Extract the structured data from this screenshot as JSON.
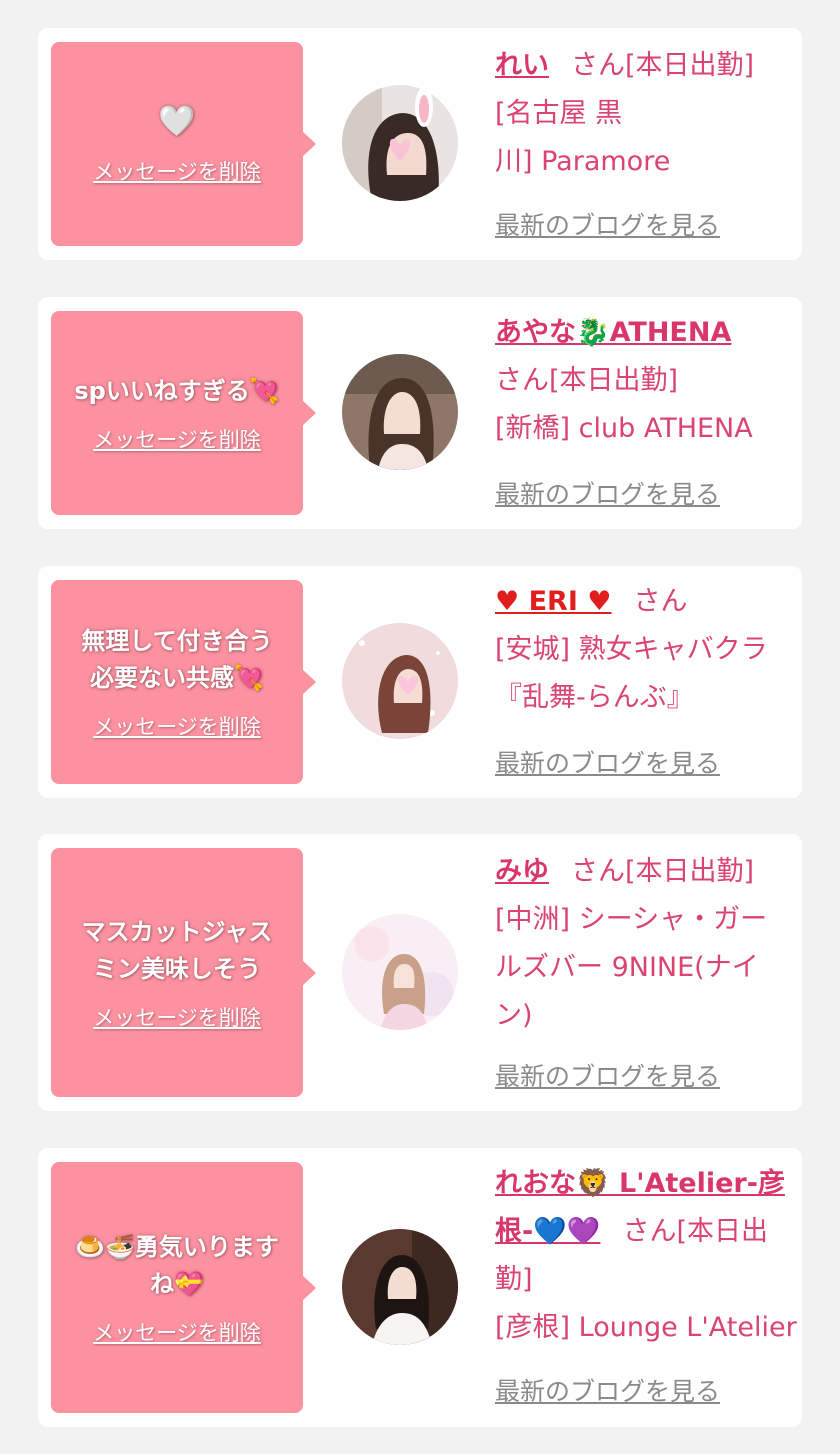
{
  "delete_label": "メッセージを削除",
  "blog_label": "最新のブログを見る",
  "colors": {
    "page_background": "#f2f2f2",
    "bubble": "#fc91a0",
    "name_text": "#d9376a",
    "link_gray": "#8a8a8a"
  },
  "cards": [
    {
      "message_emoji": "🤍",
      "message_lines": [],
      "name": "れい",
      "suffix": "さん[本日出勤]",
      "shop_lines": [
        "[名古屋 黒",
        "川] Paramore"
      ],
      "avatar_icon": "woman-bunny-ears-avatar"
    },
    {
      "message_lines": [
        "spいいねすぎる💘"
      ],
      "name": "あやな🐉ATHENA",
      "suffix_lines": [
        "さん[本日出勤]"
      ],
      "shop_lines": [
        "[新橋] club ATHENA"
      ],
      "avatar_icon": "woman-portrait-avatar"
    },
    {
      "message_lines": [
        "無理して付き合う",
        "必要ない共感💘"
      ],
      "name": "♥ ERI ♥",
      "suffix": "さん",
      "shop_lines": [
        "[安城] 熟女キャバクラ",
        "『乱舞-らんぶ』"
      ],
      "avatar_icon": "woman-sparkle-avatar"
    },
    {
      "message_lines": [
        "マスカットジャス",
        "ミン美味しそう"
      ],
      "name": "みゆ",
      "suffix": "さん[本日出勤]",
      "shop_lines": [
        "[中洲] シーシャ・ガー",
        "ルズバー 9NINE(ナイ",
        "ン)"
      ],
      "avatar_icon": "woman-pastel-avatar"
    },
    {
      "message_lines": [
        "🍮🍜勇気いります",
        "ね💝"
      ],
      "name_line1": "れおな🦁 L'Atelier-彦",
      "name_line2": "根-💙💜",
      "suffix_inline": "さん[本日出",
      "suffix_tail": "勤]",
      "shop_lines": [
        "[彦根] Lounge L'Atelier"
      ],
      "avatar_icon": "woman-white-dress-avatar"
    }
  ]
}
